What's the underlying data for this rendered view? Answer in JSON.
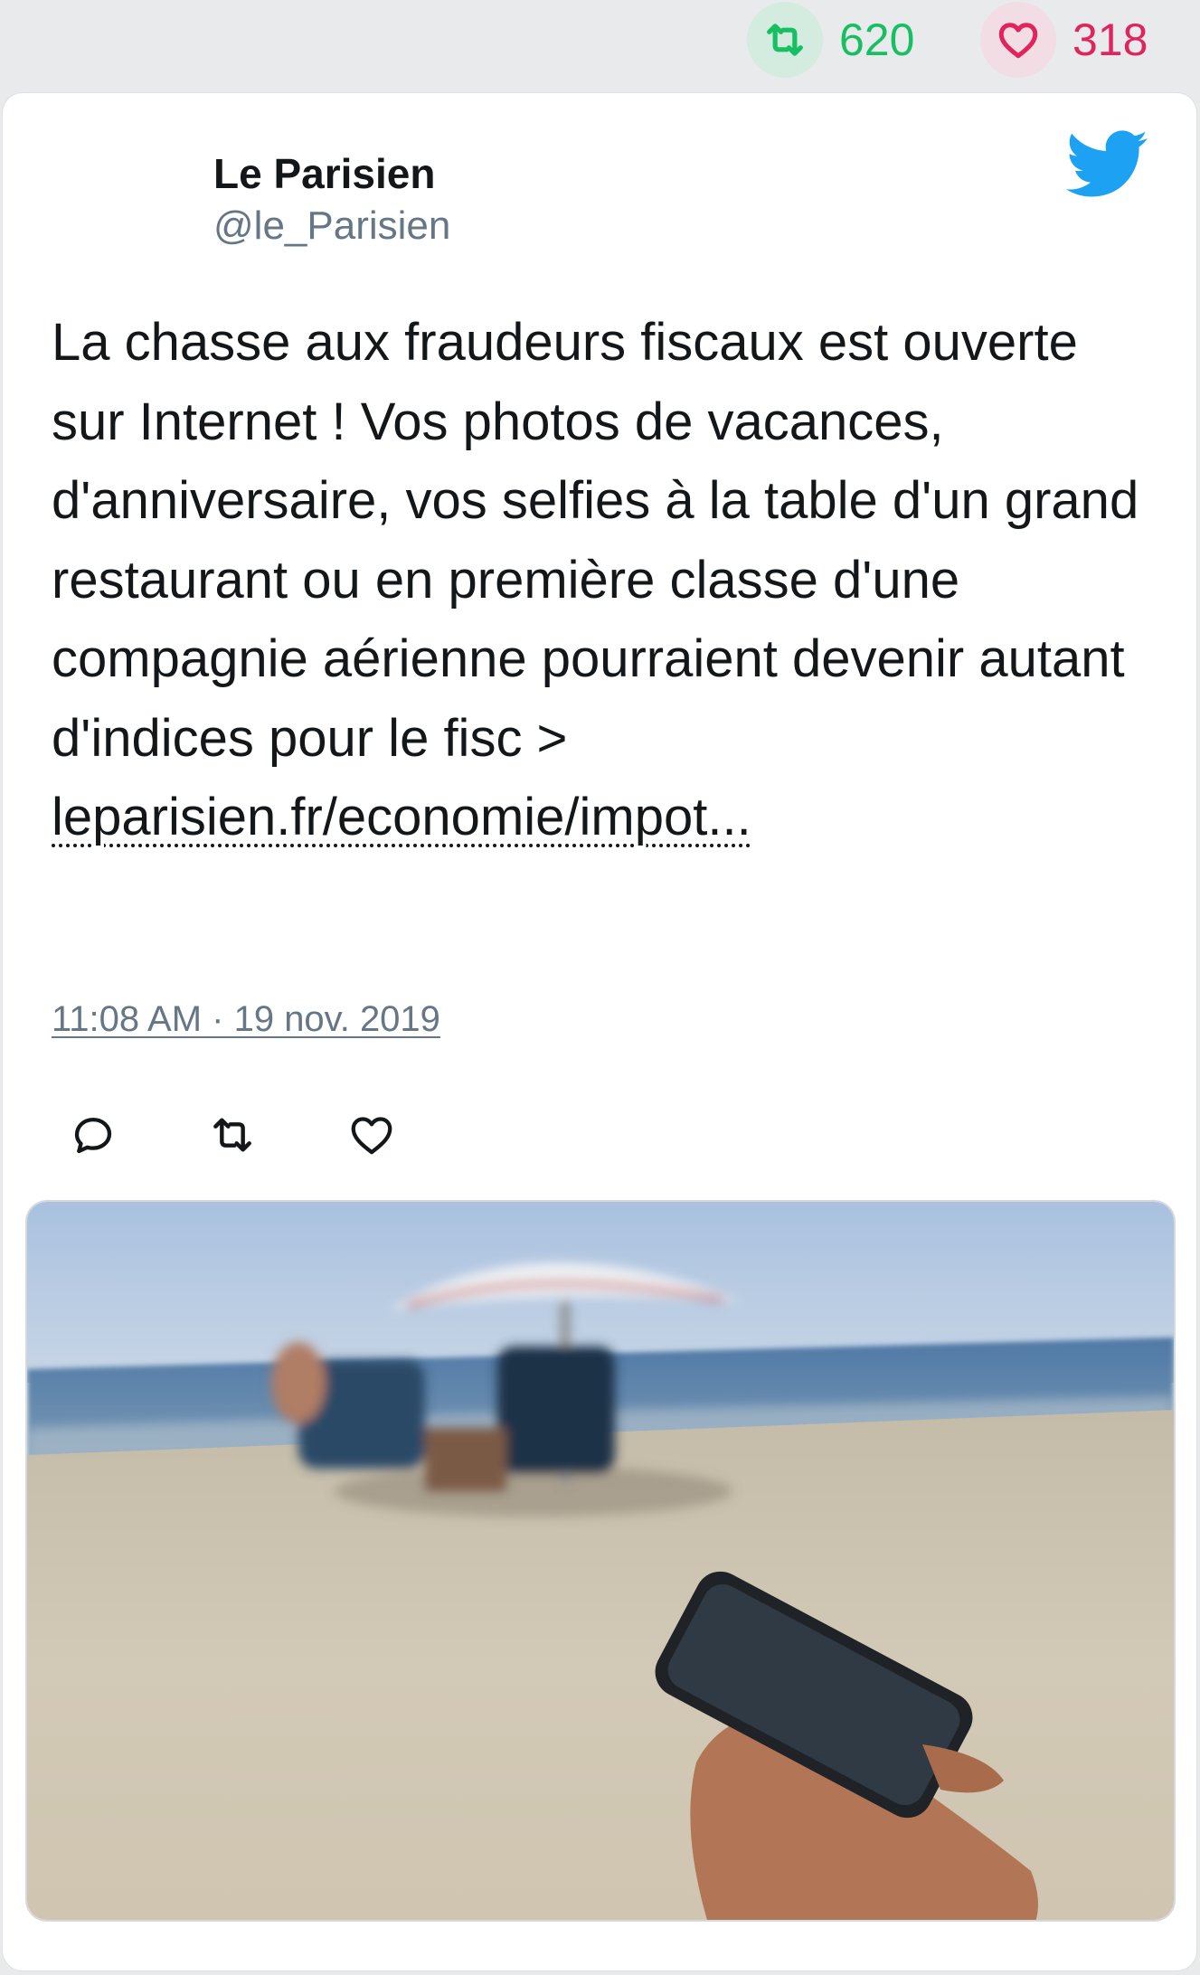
{
  "stats": {
    "retweets": "620",
    "likes": "318",
    "retweet_color": "#17bf63",
    "like_color": "#e0245e"
  },
  "author": {
    "name": "Le Parisien",
    "handle": "@le_Parisien"
  },
  "tweet": {
    "text": "La chasse aux fraudeurs fiscaux est ouverte sur Internet ! Vos photos de vacances, d'anniversaire, vos selfies à la table d'un grand restaurant ou en première classe d'une compagnie aérienne pourraient devenir autant d'indices pour le fisc > ",
    "link": "leparisien.fr/economie/impot...",
    "timestamp": "11:08 AM · 19 nov. 2019"
  },
  "icons": {
    "brand": "twitter-bird-icon",
    "actions": [
      "reply-icon",
      "retweet-icon",
      "like-icon"
    ]
  },
  "colors": {
    "brand_blue": "#1da1f2",
    "text": "#14171a",
    "muted": "#657786"
  }
}
